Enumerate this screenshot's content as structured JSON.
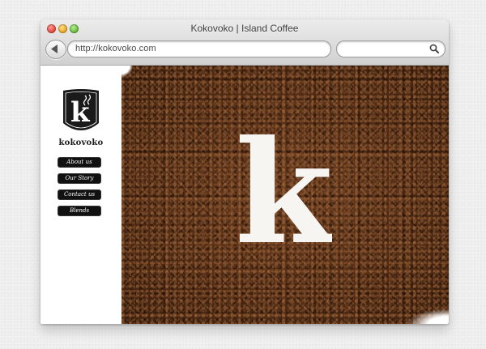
{
  "browser": {
    "title": "Kokovoko | Island Coffee",
    "url": "http://kokovoko.com",
    "search_placeholder": ""
  },
  "sidebar": {
    "brand": "kokovoko",
    "nav": [
      {
        "label": "About us"
      },
      {
        "label": "Our Story"
      },
      {
        "label": "Contact us"
      },
      {
        "label": "Blends"
      }
    ]
  },
  "icons": {
    "back": "back-arrow-icon",
    "search": "search-icon",
    "logo": "kokovoko-logo-icon"
  },
  "colors": {
    "coffee": "#5a3218",
    "nav_bg": "#111111"
  }
}
